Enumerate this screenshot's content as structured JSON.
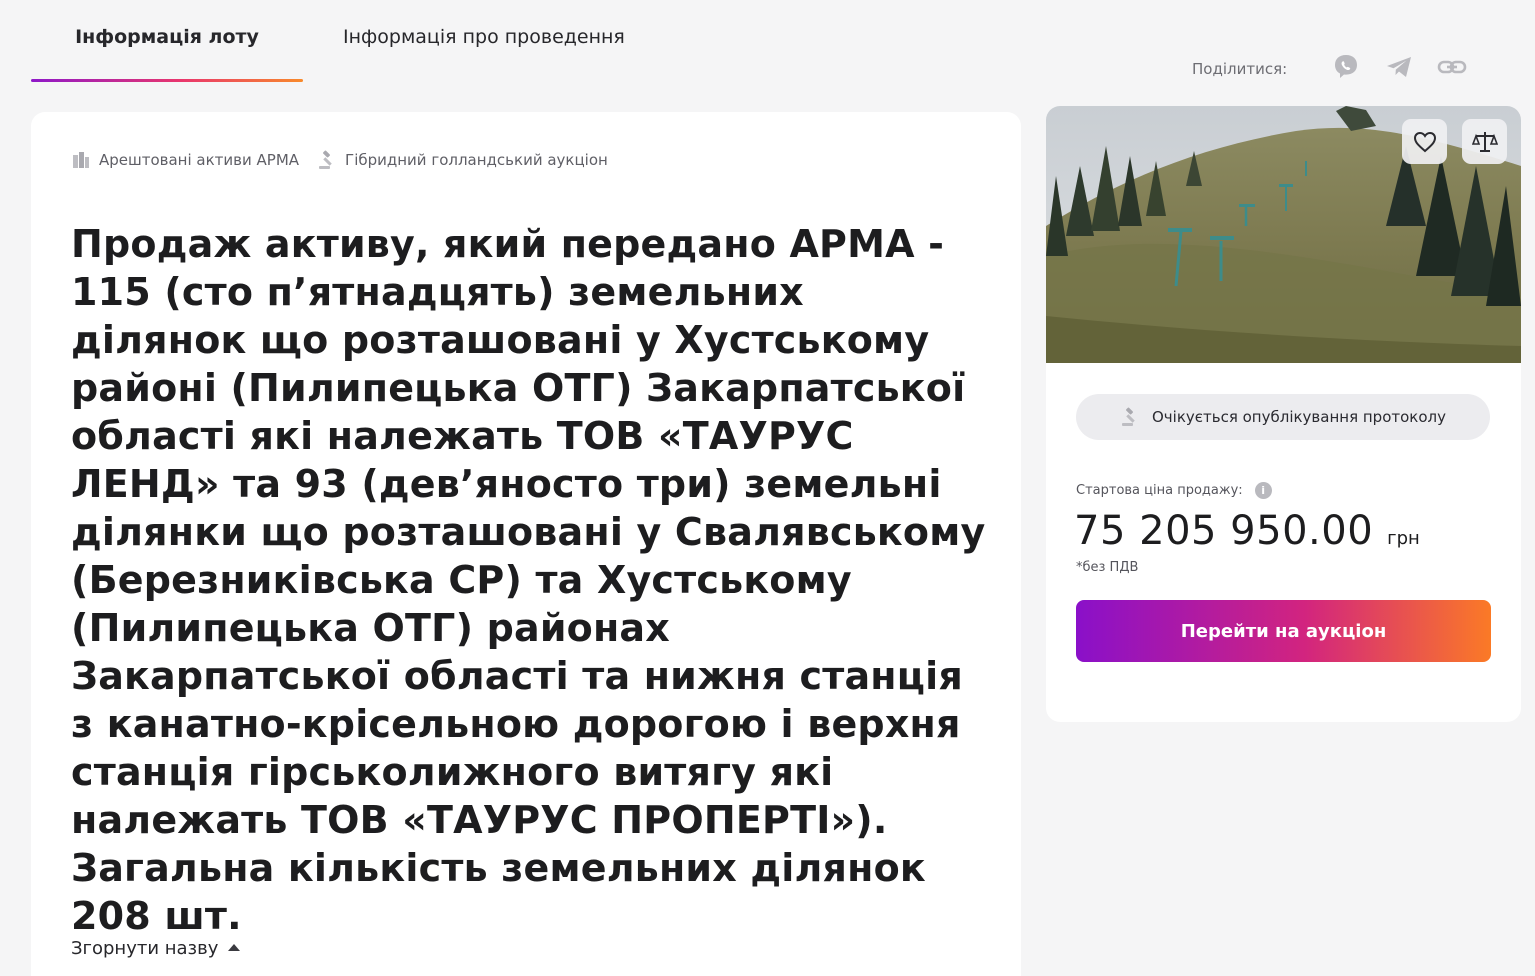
{
  "tabs": [
    {
      "label": "Інформація лоту",
      "active": true
    },
    {
      "label": "Інформація про проведення",
      "active": false
    }
  ],
  "share": {
    "label": "Поділитися:",
    "icons": [
      "viber-icon",
      "telegram-icon",
      "link-icon"
    ]
  },
  "lot": {
    "category": "Арештовані активи АРМА",
    "auction_type": "Гібридний голландський аукціон",
    "title": "Продаж активу, який передано АРМА - 115 (сто п’ятнадцять) земельних ділянок що розташовані у Хустському районі (Пилипецька ОТГ) Закарпатської області які належать ТОВ «ТАУРУС ЛЕНД» та 93 (дев’яносто три) земельні ділянки що розташовані у Свалявському (Березниківська СР) та Хустському (Пилипецька ОТГ) районах Закарпатської області та нижня станція з канатно-крісельною дорогою і верхня станція гірськолижного витягу які належать ТОВ «ТАУРУС ПРОПЕРТІ»). Загальна кількість земельних ділянок 208 шт.",
    "collapse_label": "Згорнути назву"
  },
  "sidebar": {
    "status": "Очікується опублікування протоколу",
    "price_label": "Стартова ціна продажу:",
    "price_value": "75 205 950.00",
    "currency": "грн",
    "vat_note": "*без ПДВ",
    "cta_label": "Перейти на аукціон"
  },
  "colors": {
    "background": "#f5f5f6",
    "accent_start": "#8a10c9",
    "accent_end": "#fb7a26"
  }
}
